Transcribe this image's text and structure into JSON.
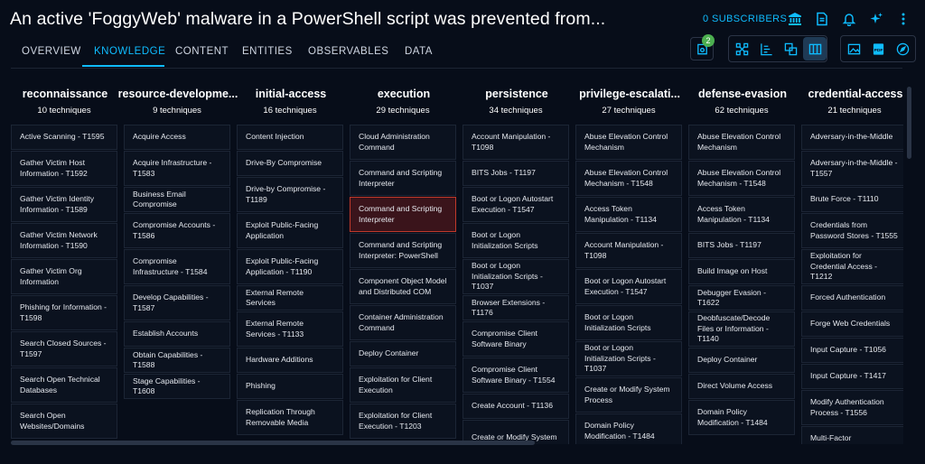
{
  "header": {
    "title": "An active 'FoggyWeb' malware in a PowerShell script was prevented from...",
    "subscribers": "0 SUBSCRIBERS",
    "buttons": [
      "bank-icon",
      "document-export-icon",
      "bell-icon",
      "sparkle-icon",
      "more-vertical-icon"
    ]
  },
  "tabs": [
    "OVERVIEW",
    "KNOWLEDGE",
    "CONTENT",
    "ENTITIES",
    "OBSERVABLES",
    "DATA"
  ],
  "active_tab": "KNOWLEDGE",
  "toolbar": {
    "notification_count": "2",
    "accent_color": "#0fbcff"
  },
  "matrix": {
    "columns": [
      {
        "name": "reconnaissance",
        "count": "10 techniques",
        "items": [
          "Active Scanning - T1595",
          "Gather Victim Host Information - T1592",
          "Gather Victim Identity Information - T1589",
          "Gather Victim Network Information - T1590",
          "Gather Victim Org Information",
          "Phishing for Information - T1598",
          "Search Closed Sources - T1597",
          "Search Open Technical Databases",
          "Search Open Websites/Domains"
        ]
      },
      {
        "name": "resource-developme...",
        "count": "9 techniques",
        "items": [
          "Acquire Access",
          "Acquire Infrastructure - T1583",
          "Business Email Compromise",
          "Compromise Accounts - T1586",
          "Compromise Infrastructure - T1584",
          "Develop Capabilities - T1587",
          "Establish Accounts",
          "Obtain Capabilities - T1588",
          "Stage Capabilities - T1608"
        ]
      },
      {
        "name": "initial-access",
        "count": "16 techniques",
        "items": [
          "Content Injection",
          "Drive-By Compromise",
          "Drive-by Compromise - T1189",
          "Exploit Public-Facing Application",
          "Exploit Public-Facing Application - T1190",
          "External Remote Services",
          "External Remote Services - T1133",
          "Hardware Additions",
          "Phishing",
          "Replication Through Removable Media"
        ]
      },
      {
        "name": "execution",
        "count": "29 techniques",
        "items": [
          "Cloud Administration Command",
          "Command and Scripting Interpreter",
          "Command and Scripting Interpreter",
          "Command and Scripting Interpreter: PowerShell",
          "Component Object Model and Distributed COM",
          "Container Administration Command",
          "Deploy Container",
          "Exploitation for Client Execution",
          "Exploitation for Client Execution - T1203"
        ],
        "highlighted_index": 2
      },
      {
        "name": "persistence",
        "count": "34 techniques",
        "items": [
          "Account Manipulation - T1098",
          "BITS Jobs - T1197",
          "Boot or Logon Autostart Execution - T1547",
          "Boot or Logon Initialization Scripts",
          "Boot or Logon Initialization Scripts - T1037",
          "Browser Extensions - T1176",
          "Compromise Client Software Binary",
          "Compromise Client Software Binary - T1554",
          "Create Account - T1136",
          "Create or Modify System"
        ]
      },
      {
        "name": "privilege-escalati...",
        "count": "27 techniques",
        "items": [
          "Abuse Elevation Control Mechanism",
          "Abuse Elevation Control Mechanism - T1548",
          "Access Token Manipulation - T1134",
          "Account Manipulation - T1098",
          "Boot or Logon Autostart Execution - T1547",
          "Boot or Logon Initialization Scripts",
          "Boot or Logon Initialization Scripts - T1037",
          "Create or Modify System Process",
          "Domain Policy Modification - T1484"
        ]
      },
      {
        "name": "defense-evasion",
        "count": "62 techniques",
        "items": [
          "Abuse Elevation Control Mechanism",
          "Abuse Elevation Control Mechanism - T1548",
          "Access Token Manipulation - T1134",
          "BITS Jobs - T1197",
          "Build Image on Host",
          "Debugger Evasion - T1622",
          "Deobfuscate/Decode Files or Information - T1140",
          "Deploy Container",
          "Direct Volume Access",
          "Domain Policy Modification - T1484"
        ]
      },
      {
        "name": "credential-access",
        "count": "21 techniques",
        "items": [
          "Adversary-in-the-Middle",
          "Adversary-in-the-Middle - T1557",
          "Brute Force - T1110",
          "Credentials from Password Stores - T1555",
          "Exploitation for Credential Access - T1212",
          "Forced Authentication",
          "Forge Web Credentials",
          "Input Capture - T1056",
          "Input Capture - T1417",
          "Modify Authentication Process - T1556",
          "Multi-Factor Authentication"
        ]
      }
    ]
  }
}
